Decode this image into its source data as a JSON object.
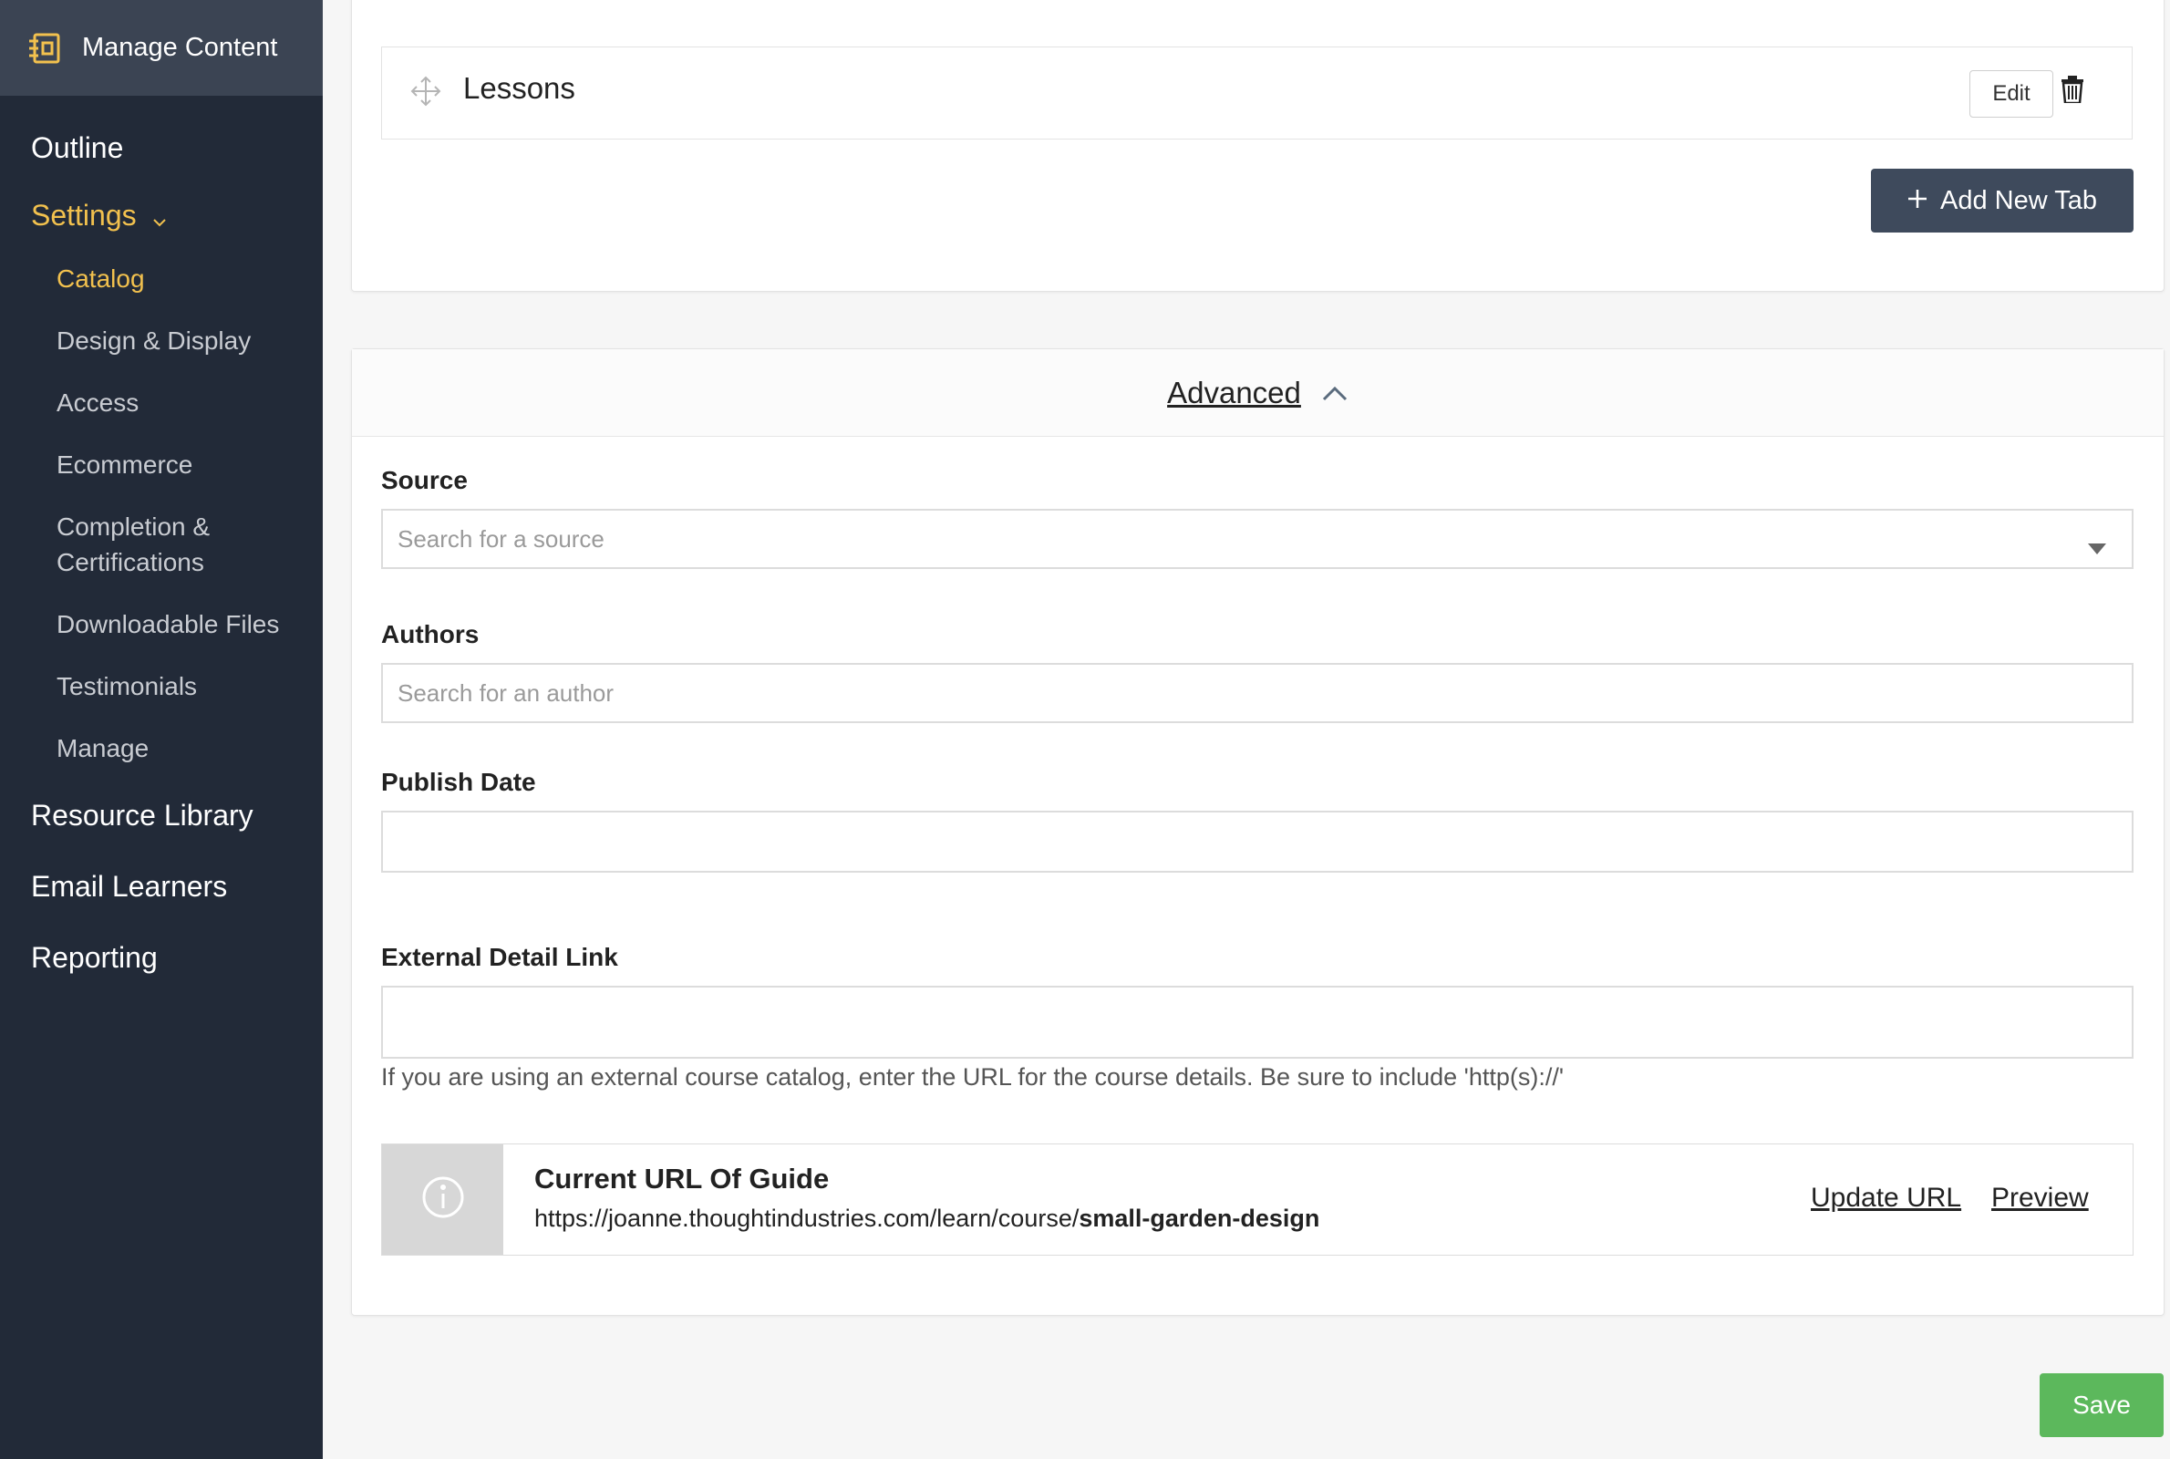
{
  "sidebar": {
    "header_label": "Manage Content",
    "items": {
      "outline": "Outline",
      "settings": "Settings",
      "resource_library": "Resource Library",
      "email_learners": "Email Learners",
      "reporting": "Reporting"
    },
    "settings_sub": {
      "catalog": "Catalog",
      "design_display": "Design & Display",
      "access": "Access",
      "ecommerce": "Ecommerce",
      "completion_line1": "Completion &",
      "completion_line2": "Certifications",
      "downloadable_files": "Downloadable Files",
      "testimonials": "Testimonials",
      "manage": "Manage"
    },
    "accent_color": "#f2c14e",
    "bg_color": "#222a38"
  },
  "tabs_card": {
    "lesson_title": "Lessons",
    "edit_label": "Edit",
    "add_tab_label": "Add New Tab"
  },
  "advanced": {
    "header_label": "Advanced",
    "source": {
      "label": "Source",
      "placeholder": "Search for a source"
    },
    "authors": {
      "label": "Authors",
      "placeholder": "Search for an author"
    },
    "publish_date": {
      "label": "Publish Date",
      "value": ""
    },
    "external_link": {
      "label": "External Detail Link",
      "value": "",
      "help": "If you are using an external course catalog, enter the URL for the course details. Be sure to include 'http(s)://'"
    },
    "current_url": {
      "title": "Current URL Of Guide",
      "base": "https://joanne.thoughtindustries.com/learn/course/",
      "slug": "small-garden-design",
      "update_label": "Update URL",
      "preview_label": "Preview"
    }
  },
  "save_label": "Save",
  "colors": {
    "save": "#5cb85c",
    "add_tab": "#3e4a5c"
  }
}
